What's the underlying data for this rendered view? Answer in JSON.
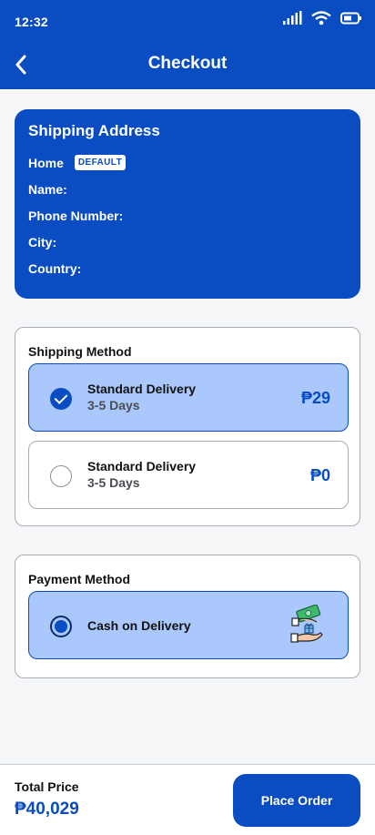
{
  "status_bar": {
    "time": "12:32"
  },
  "header": {
    "title": "Checkout"
  },
  "shipping_address": {
    "title": "Shipping Address",
    "label": "Home",
    "badge": "DEFAULT",
    "fields": [
      "Name:",
      "Phone Number:",
      "City:",
      "Country:"
    ]
  },
  "shipping_method": {
    "title": "Shipping Method",
    "options": [
      {
        "name": "Standard Delivery",
        "days": "3-5 Days",
        "price": "₱29",
        "selected": true
      },
      {
        "name": "Standard Delivery",
        "days": "3-5 Days",
        "price": "₱0",
        "selected": false
      }
    ]
  },
  "payment_method": {
    "title": "Payment Method",
    "option": {
      "name": "Cash on Delivery",
      "icon": "cash-on-delivery-icon",
      "selected": true
    }
  },
  "footer": {
    "total_label": "Total Price",
    "total_value": "₱40,029",
    "button_label": "Place Order"
  },
  "colors": {
    "primary": "#0a4cc2",
    "selected_bg": "#aac8fb",
    "background": "#f5f6f8"
  }
}
